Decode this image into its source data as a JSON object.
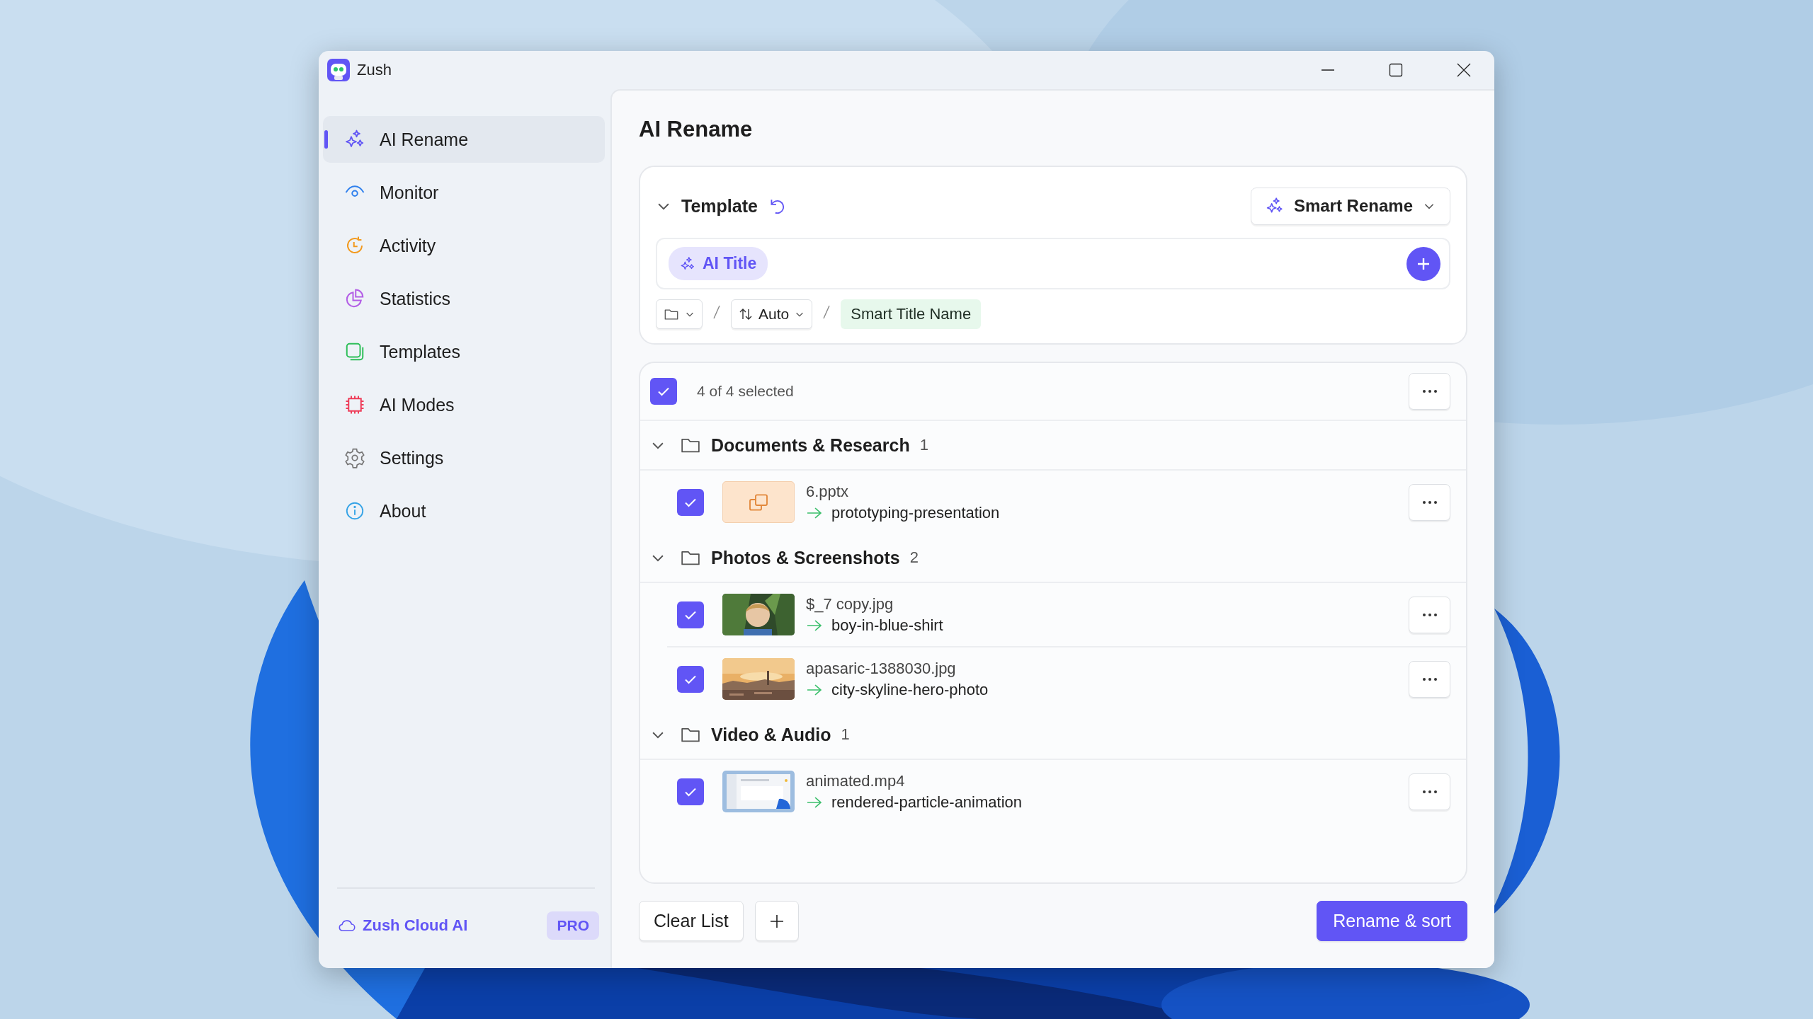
{
  "window": {
    "title": "Zush"
  },
  "sidebar": {
    "items": [
      {
        "label": "AI Rename",
        "selected": true
      },
      {
        "label": "Monitor",
        "selected": false
      },
      {
        "label": "Activity",
        "selected": false
      },
      {
        "label": "Statistics",
        "selected": false
      },
      {
        "label": "Templates",
        "selected": false
      },
      {
        "label": "AI Modes",
        "selected": false
      },
      {
        "label": "Settings",
        "selected": false
      },
      {
        "label": "About",
        "selected": false
      }
    ],
    "footer": {
      "label": "Zush Cloud AI",
      "badge": "PRO"
    }
  },
  "page": {
    "title": "AI Rename"
  },
  "template": {
    "title": "Template",
    "expanded": true,
    "mode": "Smart Rename",
    "tokens": [
      "AI Title"
    ],
    "sort": "Auto",
    "name_part": "Smart Title Name"
  },
  "list": {
    "select_all": {
      "checked": true,
      "label": "4 of 4 selected"
    },
    "groups": [
      {
        "name": "Documents & Research",
        "count": "1",
        "expanded": true,
        "files": [
          {
            "checked": true,
            "kind": "document",
            "name": "6.pptx",
            "new_name": "prototyping-presentation"
          }
        ]
      },
      {
        "name": "Photos & Screenshots",
        "count": "2",
        "expanded": true,
        "files": [
          {
            "checked": true,
            "kind": "portrait",
            "name": "$_7 copy.jpg",
            "new_name": "boy-in-blue-shirt"
          },
          {
            "checked": true,
            "kind": "skyline",
            "name": "apasaric-1388030.jpg",
            "new_name": "city-skyline-hero-photo"
          }
        ]
      },
      {
        "name": "Video & Audio",
        "count": "1",
        "expanded": true,
        "files": [
          {
            "checked": true,
            "kind": "screen",
            "name": "animated.mp4",
            "new_name": "rendered-particle-animation"
          }
        ]
      }
    ]
  },
  "actions": {
    "clear": "Clear List",
    "primary": "Rename & sort"
  }
}
